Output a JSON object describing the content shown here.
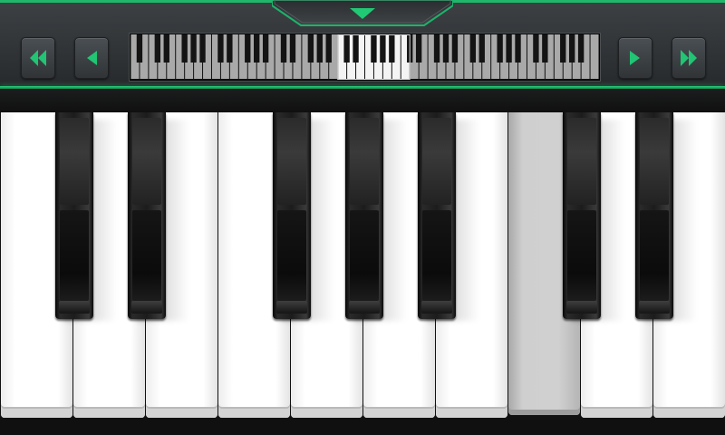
{
  "app": {
    "title": ""
  },
  "colors": {
    "accent": "#1fb86a",
    "accent_glow": "#29d07c",
    "bar_bg": "#33373a",
    "white_key": "#ffffff",
    "pressed_key": "#c8c8c8",
    "black_key": "#1c1c1c"
  },
  "toolbar": {
    "menu_tab_icon": "chevron-down-icon",
    "buttons": [
      {
        "id": "fast-back",
        "icon": "double-arrow-left-icon"
      },
      {
        "id": "back",
        "icon": "arrow-left-icon"
      },
      {
        "id": "forward",
        "icon": "arrow-right-icon"
      },
      {
        "id": "fast-forward",
        "icon": "double-arrow-right-icon"
      }
    ]
  },
  "mini_keyboard": {
    "white_key_count": 52,
    "visible_window_start": 23,
    "visible_window_size": 8
  },
  "keyboard": {
    "white_keys": 10,
    "pressed_white_key_index": 7,
    "black_key_after_white_index": [
      0,
      1,
      3,
      4,
      5,
      7,
      8
    ]
  }
}
